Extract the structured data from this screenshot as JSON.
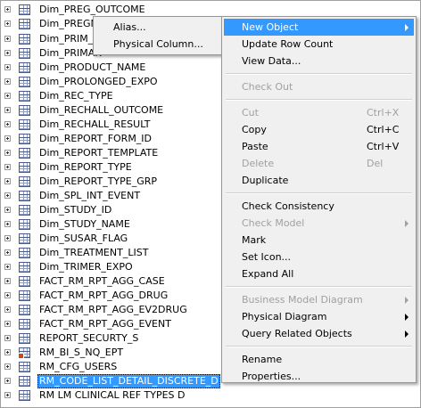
{
  "tree": {
    "items": [
      {
        "label": "Dim_PREG_OUTCOME",
        "icon": "table-icon"
      },
      {
        "label": "Dim_PREGN",
        "icon": "table-icon"
      },
      {
        "label": "Dim_PRIM_S",
        "icon": "table-icon"
      },
      {
        "label": "Dim_PRIMAR",
        "icon": "table-icon"
      },
      {
        "label": "Dim_PRODUCT_NAME",
        "icon": "table-icon"
      },
      {
        "label": "Dim_PROLONGED_EXPO",
        "icon": "table-icon"
      },
      {
        "label": "Dim_REC_TYPE",
        "icon": "table-icon"
      },
      {
        "label": "Dim_RECHALL_OUTCOME",
        "icon": "table-icon"
      },
      {
        "label": "Dim_RECHALL_RESULT",
        "icon": "table-icon"
      },
      {
        "label": "Dim_REPORT_FORM_ID",
        "icon": "table-icon"
      },
      {
        "label": "Dim_REPORT_TEMPLATE",
        "icon": "table-icon"
      },
      {
        "label": "Dim_REPORT_TYPE",
        "icon": "table-icon"
      },
      {
        "label": "Dim_REPORT_TYPE_GRP",
        "icon": "table-icon"
      },
      {
        "label": "Dim_SPL_INT_EVENT",
        "icon": "table-icon"
      },
      {
        "label": "Dim_STUDY_ID",
        "icon": "table-icon"
      },
      {
        "label": "Dim_STUDY_NAME",
        "icon": "table-icon"
      },
      {
        "label": "Dim_SUSAR_FLAG",
        "icon": "table-icon"
      },
      {
        "label": "Dim_TREATMENT_LIST",
        "icon": "table-icon"
      },
      {
        "label": "Dim_TRIMER_EXPO",
        "icon": "table-icon"
      },
      {
        "label": "FACT_RM_RPT_AGG_CASE",
        "icon": "table-icon"
      },
      {
        "label": "FACT_RM_RPT_AGG_DRUG",
        "icon": "table-icon"
      },
      {
        "label": "FACT_RM_RPT_AGG_EV2DRUG",
        "icon": "table-icon"
      },
      {
        "label": "FACT_RM_RPT_AGG_EVENT",
        "icon": "table-icon"
      },
      {
        "label": "REPORT_SECURTY_S",
        "icon": "table-icon"
      },
      {
        "label": "RM_BI_S_NQ_EPT",
        "icon": "table-icon"
      },
      {
        "label": "RM_CFG_USERS",
        "icon": "table-icon"
      },
      {
        "label": "RM_CODE_LIST_DETAIL_DISCRETE_D",
        "icon": "table-icon"
      },
      {
        "label": "RM LM CLINICAL REF TYPES D",
        "icon": "table-icon"
      }
    ]
  },
  "submenu": {
    "items": [
      {
        "label": "Alias..."
      },
      {
        "label": "Physical Column..."
      }
    ]
  },
  "context_menu": {
    "items": [
      {
        "label": "New Object",
        "arrow": true
      },
      {
        "label": "Update Row Count"
      },
      {
        "label": "View Data..."
      },
      {
        "sep": true
      },
      {
        "label": "Check Out",
        "disabled": true
      },
      {
        "sep": true
      },
      {
        "label": "Cut",
        "shortcut": "Ctrl+X",
        "disabled": true
      },
      {
        "label": "Copy",
        "shortcut": "Ctrl+C"
      },
      {
        "label": "Paste",
        "shortcut": "Ctrl+V"
      },
      {
        "label": "Delete",
        "shortcut": "Del",
        "disabled": true
      },
      {
        "label": "Duplicate"
      },
      {
        "sep": true
      },
      {
        "label": "Check Consistency"
      },
      {
        "label": "Check Model",
        "arrow": true,
        "disabled": true
      },
      {
        "label": "Mark"
      },
      {
        "label": "Set Icon..."
      },
      {
        "label": "Expand All"
      },
      {
        "sep": true
      },
      {
        "label": "Business Model Diagram",
        "arrow": true,
        "disabled": true
      },
      {
        "label": "Physical Diagram",
        "arrow": true
      },
      {
        "label": "Query Related Objects",
        "arrow": true
      },
      {
        "sep": true
      },
      {
        "label": "Rename"
      },
      {
        "label": "Properties..."
      }
    ]
  },
  "colors": {
    "selection": "#3399ff",
    "menu_bg": "#f0f0f0",
    "disabled_text": "#a0a0a0"
  }
}
